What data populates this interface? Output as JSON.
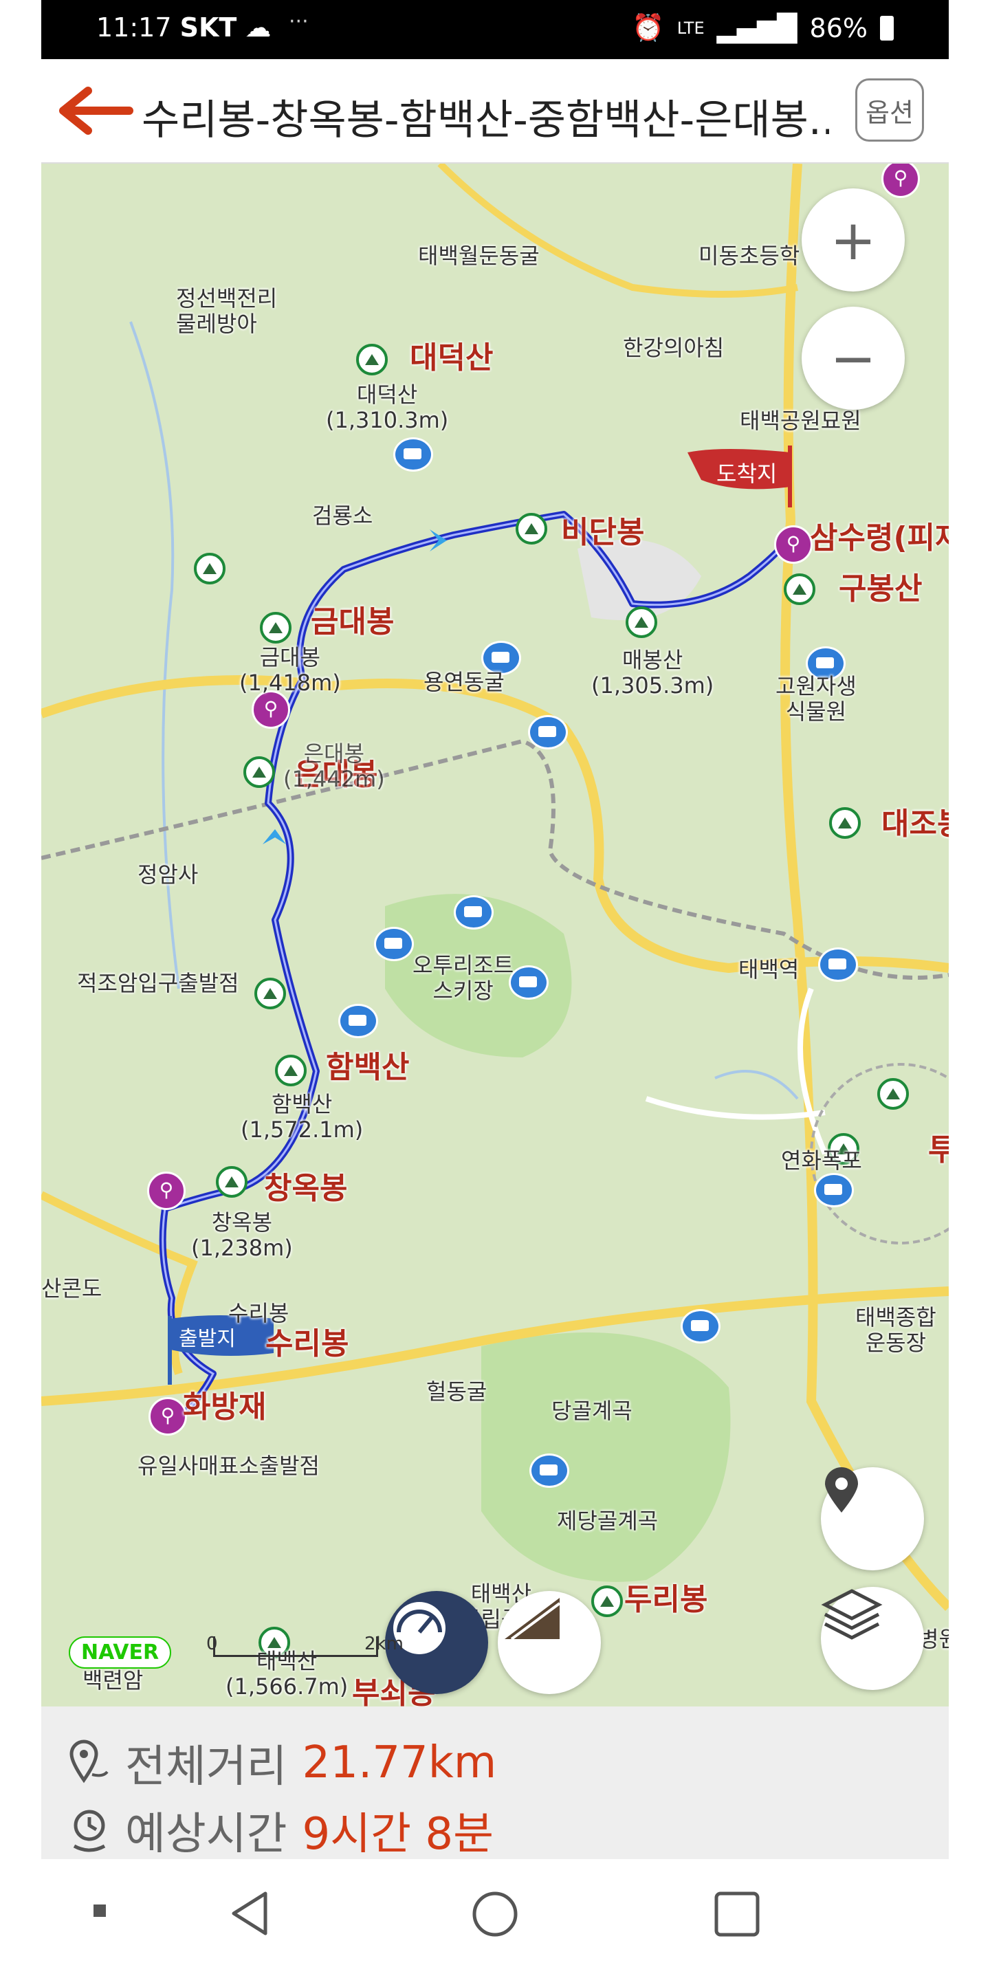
{
  "status_bar": {
    "time": "11:17",
    "carrier": "SKT",
    "dots": "···",
    "battery": "86%"
  },
  "header": {
    "title": "수리봉-창옥봉-함백산-중함백산-은대봉..",
    "options_label": "옵션"
  },
  "map": {
    "labels": {
      "taebaek_cave": "태백월둔동굴",
      "midong_school": "미동초등학",
      "jeongseon_mill": "정선백전리\n물레방아",
      "daedeoksan_big": "대덕산",
      "daedeoksan_small": "대덕산\n(1,310.3m)",
      "hangang_source": "한강의아침",
      "taebaek_cemetery": "태백공원묘원",
      "geomryongso": "검룡소",
      "bidanbong": "비단봉",
      "samsuryeong": "삼수령(피재",
      "gubongsan": "구봉산",
      "geumdaebong_big": "금대봉",
      "geumdaebong_small": "금대봉\n(1,418m)",
      "yongyeon_cave": "용연동굴",
      "maebongsan": "매봉산\n(1,305.3m)",
      "highland_plants": "고원자생\n식물원",
      "eundaebong_big": "은대봉",
      "eundaebong_small": "은대봉\n(1,442m)",
      "daejobong": "대조봉",
      "jeongamsa": "정암사",
      "jeokjoam": "적조암입구출발점",
      "ski": "오투리조트\n스키장",
      "taebaek_station": "태백역",
      "hambaeksan_big": "함백산",
      "hambaeksan_small": "함백산\n(1,572.1m)",
      "changokbong_big": "창옥봉",
      "changokbong_small": "창옥봉\n(1,238m)",
      "yeonhwa_falls": "연화폭포",
      "sankondo": "산콘도",
      "surribong_small": "수리봉",
      "surribong_big": "수리봉",
      "taebaek_stadium": "태백종합\n운동장",
      "hwabangjae": "화방재",
      "heoldong_cave": "헐동굴",
      "danggol": "당골계곡",
      "yuilsa": "유일사매표소출발점",
      "jedanggol": "제당골계곡",
      "taebaeksan_park": "태백산\n국립공원",
      "durribong": "두리봉",
      "baengnyeonam": "백련암",
      "taebaeksan_peak": "태백산\n(1,566.7m)",
      "bumsoebong": "부쇠봉",
      "tu": "투",
      "hospital": "병원"
    },
    "flag_start": "출발지",
    "flag_end": "도착지",
    "naver": "NAVER",
    "scale_start": "0",
    "scale_end": "2km",
    "zoom_in": "+",
    "zoom_out": "−"
  },
  "route_info": {
    "distance_label": "전체거리",
    "distance_value": "21.77km",
    "time_label": "예상시간",
    "time_value": "9시간 8분"
  },
  "colors": {
    "accent": "#d23b15",
    "route": "#1f2fc4",
    "map_bg": "#d9e7c4",
    "peak_label": "#b0291a"
  }
}
